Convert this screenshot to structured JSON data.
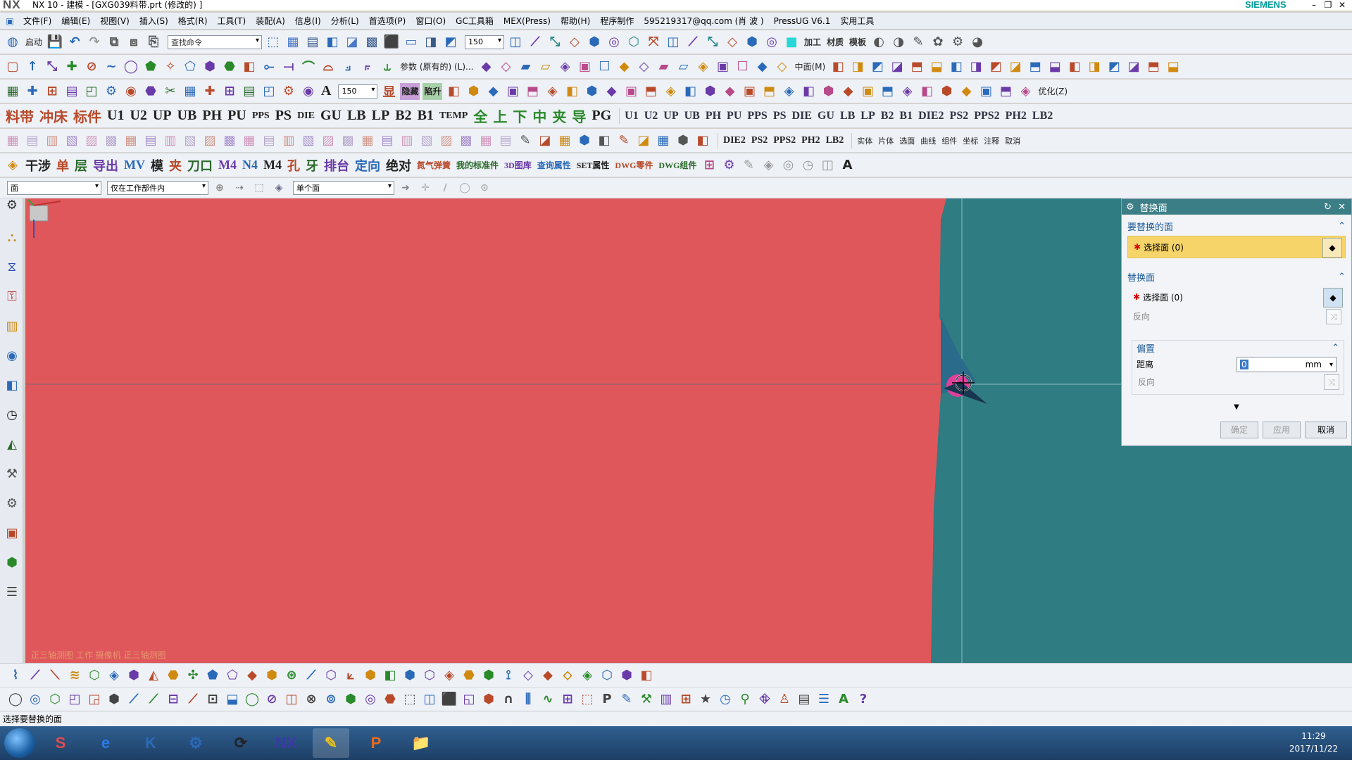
{
  "window": {
    "logo": "NX",
    "title": "NX 10 - 建模 - [GXG039料带.prt (修改的) ]",
    "brand": "SIEMENS",
    "minimize": "–",
    "restore": "❐",
    "close": "✕"
  },
  "menubar": {
    "items": [
      "文件(F)",
      "编辑(E)",
      "视图(V)",
      "插入(S)",
      "格式(R)",
      "工具(T)",
      "装配(A)",
      "信息(I)",
      "分析(L)",
      "首选项(P)",
      "窗口(O)",
      "GC工具箱",
      "MEX(Press)",
      "帮助(H)",
      "程序制作",
      "595219317@qq.com (肖 波 )",
      "PressUG V6.1",
      "实用工具"
    ]
  },
  "toolbar1": {
    "start_label": "启动",
    "search_placeholder": "查找命令",
    "zoom_value": "150",
    "labels": [
      "加工",
      "材质",
      "模板"
    ]
  },
  "toolbar2": {
    "param_label": "参数 (原有的) (L)...",
    "mid_label": "中面(M)"
  },
  "toolbar3": {
    "font_value": "150",
    "hide_label": "隐藏",
    "show_label": "陷升",
    "optimize_label": "优化(Z)"
  },
  "toolbar4": {
    "items": [
      "料带",
      "冲床",
      "标件",
      "U1",
      "U2",
      "UP",
      "UB",
      "PH",
      "PU",
      "PPS",
      "PS",
      "DIE",
      "GU",
      "LB",
      "LP",
      "B2",
      "B1",
      "TEMP",
      "全",
      "上",
      "下",
      "中",
      "夹",
      "导",
      "PG"
    ],
    "right_items": [
      "U1",
      "U2",
      "UP",
      "UB",
      "PH",
      "PU",
      "PPS",
      "PS",
      "DIE",
      "GU",
      "LB",
      "LP",
      "B2",
      "B1",
      "DIE2",
      "PS2",
      "PPS2",
      "PH2",
      "LB2"
    ]
  },
  "toolbar5": {
    "items": [
      "DIE2",
      "PS2",
      "PPS2",
      "PH2",
      "LB2"
    ],
    "right_words": [
      "实体",
      "片体",
      "选面",
      "曲线",
      "组件",
      "坐标",
      "注释",
      "取消"
    ]
  },
  "toolbar6": {
    "items": [
      "干涉",
      "单",
      "层",
      "导出",
      "MV",
      "模",
      "夹",
      "刀口",
      "M4",
      "N4",
      "M4",
      "孔",
      "牙",
      "排台",
      "定向",
      "绝对",
      "氮气弹簧",
      "我的标准件",
      "3D图库",
      "查询属性",
      "SET属性",
      "DWG零件",
      "DWG组件"
    ]
  },
  "selection_bar": {
    "filter_value": "面",
    "scope_value": "仅在工作部件内",
    "rule_value": "单个面"
  },
  "dialog": {
    "title": "替换面",
    "group1_title": "要替换的面",
    "group1_select": "选择面 (0)",
    "group2_title": "替换面",
    "group2_select": "选择面 (0)",
    "reverse_label": "反向",
    "offset_title": "偏置",
    "distance_label": "距离",
    "distance_value": "0",
    "distance_unit": "mm",
    "reverse2_label": "反向",
    "ok_label": "确定",
    "apply_label": "应用",
    "cancel_label": "取消"
  },
  "graphics": {
    "view_label": "正三轴测图 工作 摄像机 正三轴测图",
    "face_color": "#df575b",
    "bg_color": "#2f7c82",
    "highlight_color": "#e0409a"
  },
  "status": {
    "prompt": "选择要替换的面"
  },
  "taskbar": {
    "time": "11:29",
    "date": "2017/11/22",
    "apps": [
      "S",
      "e",
      "K",
      "⚙",
      "⟳",
      "NX",
      "✎",
      "P",
      "📁"
    ]
  }
}
